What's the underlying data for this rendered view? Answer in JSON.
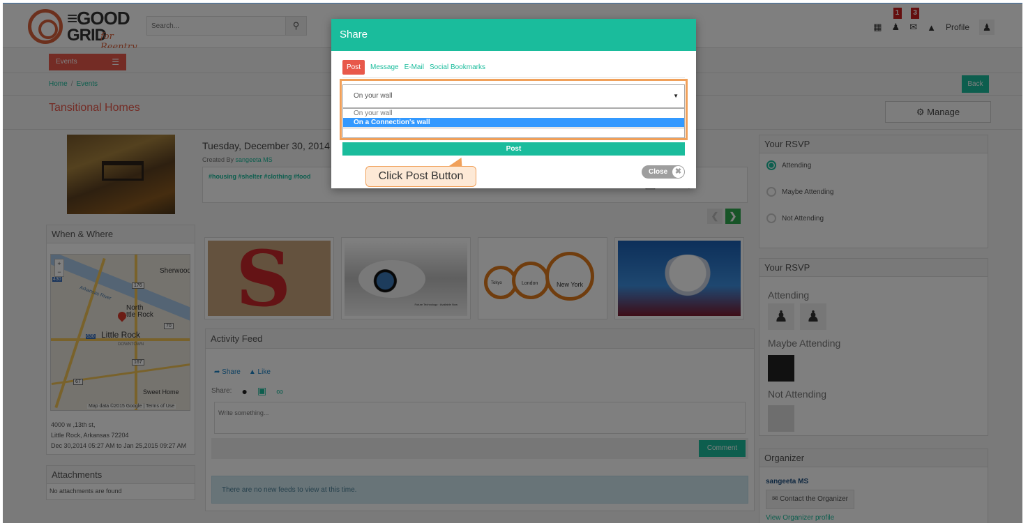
{
  "header": {
    "logo_line1": "≡GOOD",
    "logo_line2": "GRID",
    "logo_tagline": "for Reentry",
    "search_placeholder": "Search...",
    "badge_connections": "1",
    "badge_messages": "3",
    "profile_label": "Profile"
  },
  "nav": {
    "events_label": "Events",
    "breadcrumb_home": "Home",
    "breadcrumb_sep": "/",
    "breadcrumb_events": "Events",
    "back_label": "Back",
    "manage_label": "Manage"
  },
  "event": {
    "title": "Tansitional Homes",
    "date": "Tuesday, December 30, 2014 5:",
    "created_by_prefix": "Created By",
    "created_by": "sangeeta MS",
    "tags": "#housing #shelter #clothing #food"
  },
  "when_where": {
    "heading": "When & Where",
    "address_line1": "4000 w ,13th st,",
    "address_line2": "Little Rock, Arkansas 72204",
    "time_range": "Dec 30,2014 05:27 AM to Jan 25,2015 09:27 AM",
    "map_labels": {
      "sherwood": "Sherwood",
      "north_little_rock": "North\nttle Rock",
      "little_rock": "Little Rock",
      "downtown": "DOWNTOWN",
      "sweet_home": "Sweet Home",
      "arkansas_river": "Arkansas River",
      "credit": "Map data ©2015 Google  |  Terms of Use",
      "hw_430": "430",
      "hw_176": "176",
      "hw_70": "70",
      "hw_630": "630",
      "hw_167": "167",
      "hw_67": "67"
    }
  },
  "attachments": {
    "heading": "Attachments",
    "empty_text": "No attachments are found"
  },
  "activity": {
    "heading": "Activity Feed",
    "share_label": "Share",
    "like_label": "Like",
    "share_prefix": "Share:",
    "write_placeholder": "Write something...",
    "comment_label": "Comment",
    "no_feeds": "There are no new feeds to view at this time."
  },
  "gallery": {
    "eye_caption": "Future Technology · Available Now",
    "clock_tokyo": "Tokyo",
    "clock_london": "London",
    "clock_newyork": "New York"
  },
  "rsvp": {
    "heading": "Your RSVP",
    "options": [
      "Attending",
      "Maybe Attending",
      "Not Attending"
    ],
    "selected": 0,
    "summary_heading": "Your RSVP",
    "attending_label": "Attending",
    "maybe_label": "Maybe Attending",
    "not_label": "Not Attending"
  },
  "organizer": {
    "heading": "Organizer",
    "name": "sangeeta MS",
    "contact_label": "Contact the Organizer",
    "profile_link": "View Organizer profile"
  },
  "modal": {
    "title": "Share",
    "tabs": [
      "Post",
      "Message",
      "E-Mail",
      "Social Bookmarks"
    ],
    "select_value": "On your wall",
    "options": [
      "On your wall",
      "On a Connection's wall"
    ],
    "highlighted_option": 1,
    "post_label": "Post",
    "close_label": "Close",
    "callout": "Click Post Button"
  },
  "colors": {
    "accent": "#1abc9c",
    "brand_red": "#e8584a",
    "highlight": "#f0a05a",
    "selected_option": "#3399ff"
  }
}
